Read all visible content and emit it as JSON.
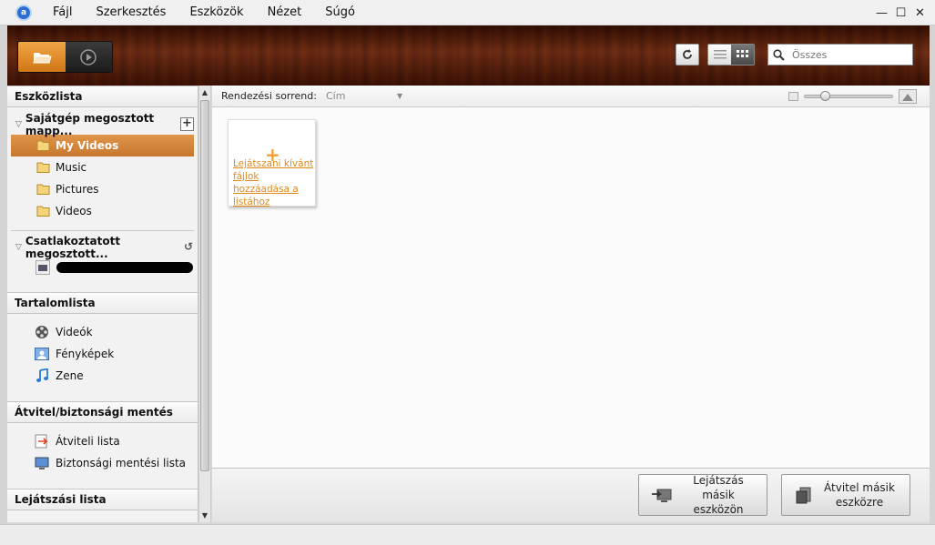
{
  "menu": {
    "items": [
      "Fájl",
      "Szerkesztés",
      "Eszközök",
      "Nézet",
      "Súgó"
    ]
  },
  "window": {
    "minimize": "—",
    "maximize": "☐",
    "close": "✕"
  },
  "search": {
    "placeholder": "Összes"
  },
  "sidebar": {
    "device_list_title": "Eszközlista",
    "my_pc_group": "Sajátgép megosztott mapp...",
    "folders": [
      {
        "label": "My Videos",
        "selected": true
      },
      {
        "label": "Music",
        "selected": false
      },
      {
        "label": "Pictures",
        "selected": false
      },
      {
        "label": "Videos",
        "selected": false
      }
    ],
    "connected_group": "Csatlakoztatott megosztott...",
    "content_list_title": "Tartalomlista",
    "content_items": [
      {
        "label": "Videók",
        "icon": "film-reel-icon"
      },
      {
        "label": "Fényképek",
        "icon": "photo-icon"
      },
      {
        "label": "Zene",
        "icon": "music-note-icon"
      }
    ],
    "transfer_title": "Átvitel/biztonsági mentés",
    "transfer_items": [
      {
        "label": "Átviteli lista",
        "icon": "transfer-list-icon"
      },
      {
        "label": "Biztonsági mentési lista",
        "icon": "backup-list-icon"
      }
    ],
    "playlist_title": "Lejátszási lista"
  },
  "sortbar": {
    "label": "Rendezési sorrend:",
    "value": "Cím",
    "zoom_level": 0.2
  },
  "main": {
    "add_files_text": "Lejátszani kívánt fájlok hozzáadása a listához"
  },
  "actions": {
    "play_other_device": "Lejátszás másik eszközön",
    "transfer_other_device": "Átvitel másik eszközre"
  },
  "colors": {
    "accent": "#d98a3c",
    "link": "#e08a1c"
  }
}
